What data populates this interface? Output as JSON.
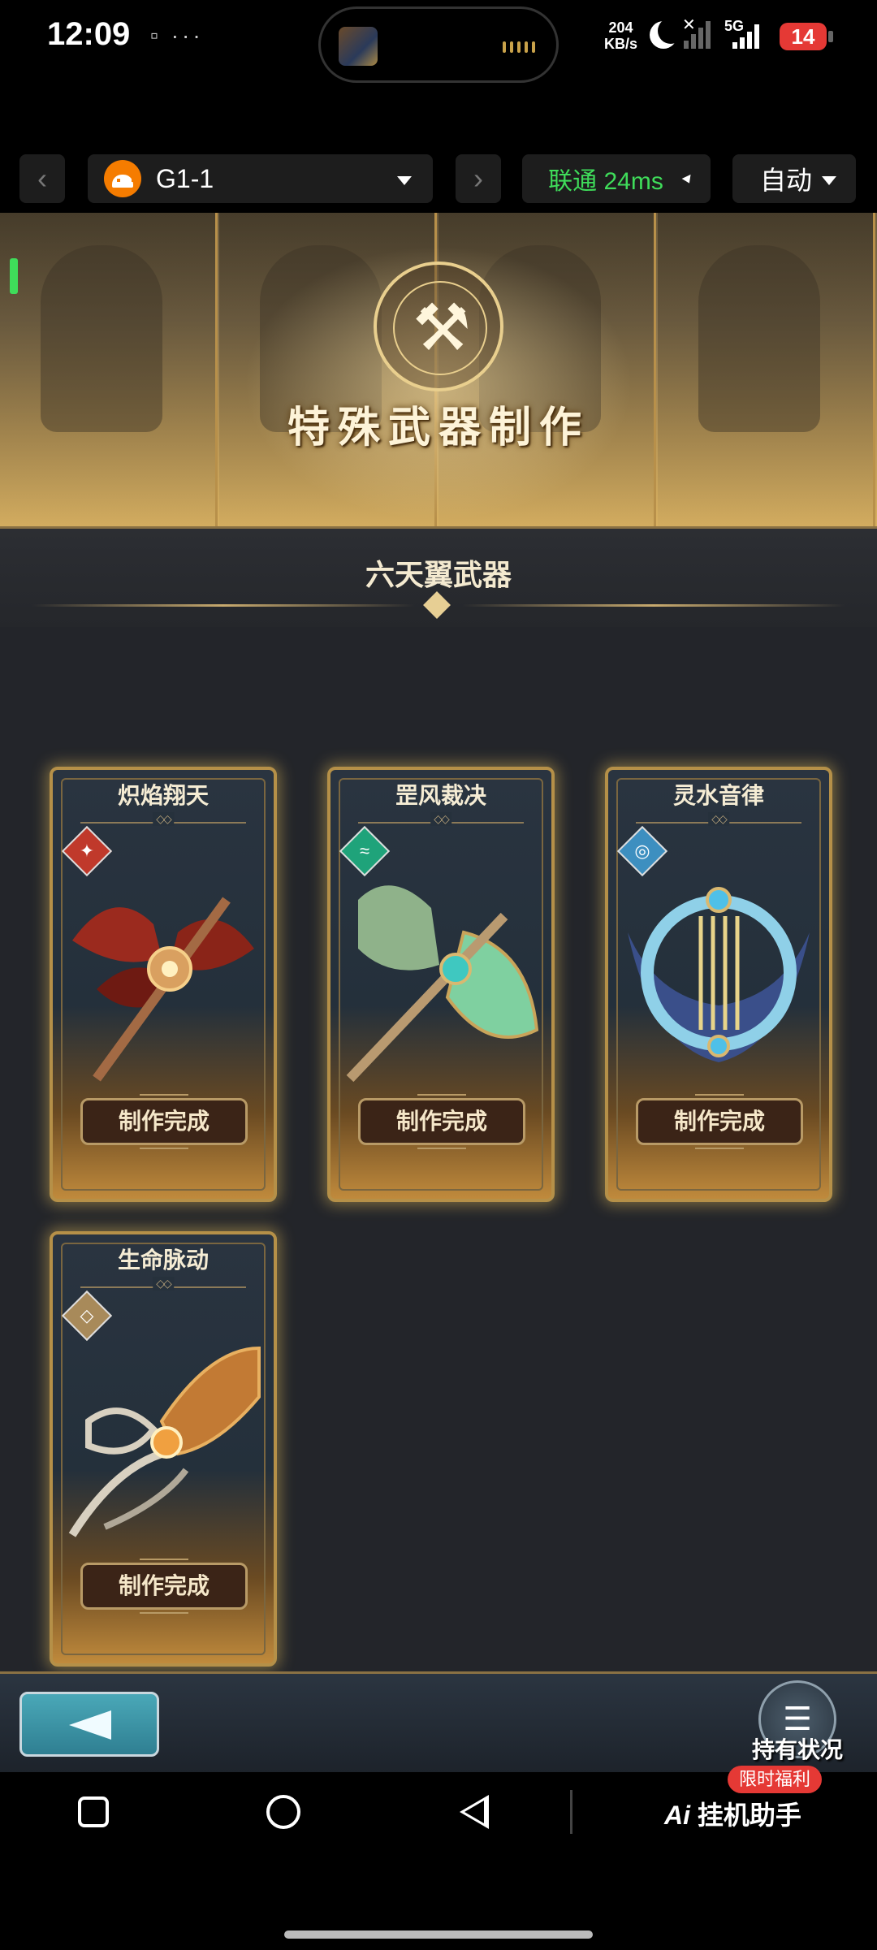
{
  "status_bar": {
    "time": "12:09",
    "notif_icons": "··· ",
    "net_speed_value": "204",
    "net_speed_unit": "KB/s",
    "network_type": "5G",
    "battery": "14"
  },
  "toolbar": {
    "device_name": "G1-1",
    "network_status": "联通 24ms",
    "mode": "自动"
  },
  "game": {
    "banner_title": "特殊武器制作",
    "section_title": "六天翼武器",
    "weapons": [
      {
        "name": "炽焰翔天",
        "element": "fire-icon",
        "element_color": "#c0392b",
        "status": "制作完成"
      },
      {
        "name": "罡风裁决",
        "element": "wind-icon",
        "element_color": "#1fa37a",
        "status": "制作完成"
      },
      {
        "name": "灵水音律",
        "element": "water-icon",
        "element_color": "#3d8fc0",
        "status": "制作完成"
      },
      {
        "name": "生命脉动",
        "element": "earth-icon",
        "element_color": "#a88a5a",
        "status": "制作完成"
      }
    ],
    "holdings_label": "持有状况"
  },
  "nav_bar": {
    "assistant_label": "挂机助手",
    "assistant_prefix": "Ai",
    "promo_badge": "限时福利"
  },
  "colors": {
    "gold": "#c8aa6e",
    "network_green": "#3fdc5a",
    "battery_red": "#e53935"
  }
}
